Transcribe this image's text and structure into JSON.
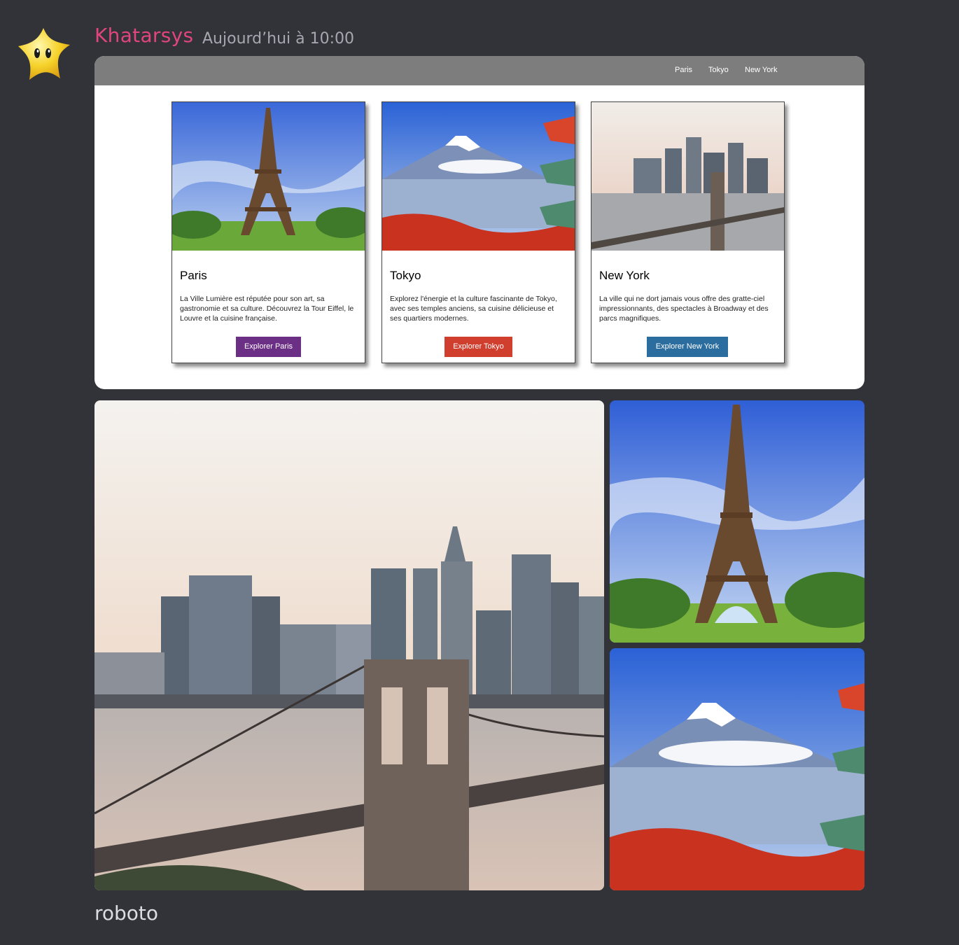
{
  "message": {
    "author": "Khatarsys",
    "timestamp": "Aujourd’hui à 10:00",
    "text": "roboto"
  },
  "embed": {
    "nav": [
      "Paris",
      "Tokyo",
      "New York"
    ],
    "cards": [
      {
        "title": "Paris",
        "description": "La Ville Lumière est réputée pour son art, sa gastronomie et sa culture. Découvrez la Tour Eiffel, le Louvre et la cuisine française.",
        "button": "Explorer Paris",
        "button_color": "#6c2f86"
      },
      {
        "title": "Tokyo",
        "description": "Explorez l'énergie et la culture fascinante de Tokyo, avec ses temples anciens, sa cuisine délicieuse et ses quartiers modernes.",
        "button": "Explorer Tokyo",
        "button_color": "#d03e2e"
      },
      {
        "title": "New York",
        "description": "La ville qui ne dort jamais vous offre des gratte-ciel impressionnants, des spectacles à Broadway et des parcs magnifiques.",
        "button": "Explorer New York",
        "button_color": "#2b6d9e"
      }
    ]
  },
  "gallery": [
    "new-york-bridge-photo",
    "eiffel-tower-photo",
    "mount-fuji-pagoda-photo"
  ],
  "colors": {
    "background": "#313338",
    "author": "#e0457b",
    "timestamp": "#a5a8b0",
    "text": "#dbdee1"
  }
}
